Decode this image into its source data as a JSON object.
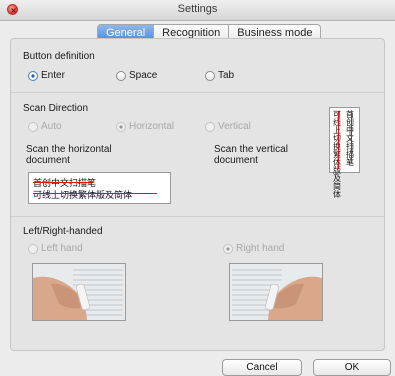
{
  "window": {
    "title": "Settings"
  },
  "tabs": [
    {
      "label": "General",
      "active": true
    },
    {
      "label": "Recognition",
      "active": false
    },
    {
      "label": "Business mode",
      "active": false
    }
  ],
  "button_definition": {
    "title": "Button definition",
    "options": [
      {
        "label": "Enter",
        "checked": true
      },
      {
        "label": "Space",
        "checked": false
      },
      {
        "label": "Tab",
        "checked": false
      }
    ]
  },
  "scan_direction": {
    "title": "Scan Direction",
    "options": [
      {
        "label": "Auto",
        "checked": false
      },
      {
        "label": "Horizontal",
        "checked": true
      },
      {
        "label": "Vertical",
        "checked": false
      }
    ],
    "horizontal_caption": "Scan the horizontal document",
    "vertical_caption": "Scan the vertical document",
    "horizontal_sample": {
      "line1": "首创中文扫描笔",
      "line2": "可线上切换繁体版及简体"
    },
    "vertical_sample": {
      "col1": "首创中文扫描笔",
      "col2": "可线上切换繁体版及简体"
    }
  },
  "handedness": {
    "title": "Left/Right-handed",
    "options": [
      {
        "label": "Left hand",
        "checked": false
      },
      {
        "label": "Right hand",
        "checked": true
      }
    ]
  },
  "footer": {
    "cancel_label": "Cancel",
    "ok_label": "OK"
  },
  "colors": {
    "accent": "#4f8bd6",
    "scan_arrow": "#e01010",
    "close_button": "#e0443e"
  }
}
